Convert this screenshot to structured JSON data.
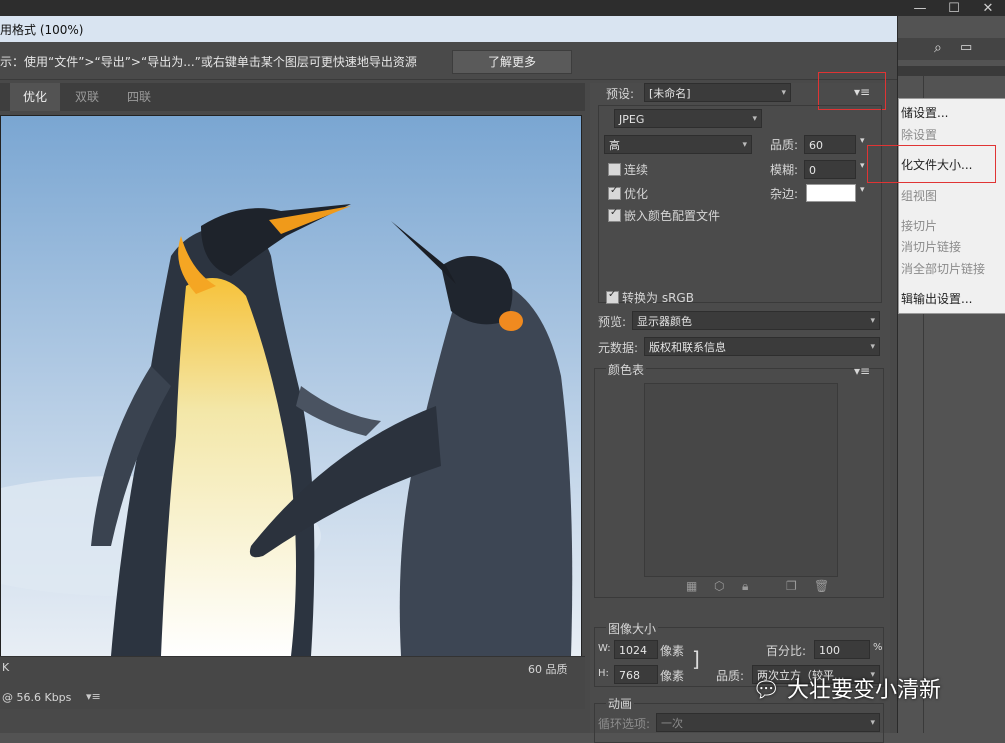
{
  "dialog": {
    "title": "用格式 (100%)",
    "hint": "示：使用“文件”>“导出”>“导出为...”或右键单击某个图层可更快速地导出资源",
    "learn_more": "了解更多"
  },
  "tabs": [
    {
      "label": "优化",
      "active": true
    },
    {
      "label": "双联",
      "active": false
    },
    {
      "label": "四联",
      "active": false
    }
  ],
  "image_info": {
    "line1": "K",
    "line2": "@ 56.6 Kbps",
    "quality": "60 品质"
  },
  "settings": {
    "preset_label": "预设:",
    "preset_value": "[未命名]",
    "format": "JPEG",
    "quality_level": "高",
    "quality_label": "品质:",
    "quality_value": "60",
    "progressive": "连续",
    "blur_label": "模糊:",
    "blur_value": "0",
    "optimized": "优化",
    "matte_label": "杂边:",
    "embed_profile": "嵌入颜色配置文件",
    "convert_srgb": "转换为 sRGB",
    "preview_label": "预览:",
    "preview_value": "显示器颜色",
    "metadata_label": "元数据:",
    "metadata_value": "版权和联系信息",
    "color_table": "颜色表"
  },
  "image_size": {
    "title": "图像大小",
    "w_label": "W:",
    "w_value": "1024",
    "h_label": "H:",
    "h_value": "768",
    "unit": "像素",
    "percent_label": "百分比:",
    "percent_value": "100",
    "percent_unit": "%",
    "quality_label": "品质:",
    "quality_value": "两次立方（较平..."
  },
  "animation": {
    "title": "动画",
    "loop_label": "循环选项:",
    "loop_value": "一次"
  },
  "context_menu": [
    {
      "label": "储设置...",
      "dim": false
    },
    {
      "label": "除设置",
      "dim": true
    },
    {
      "label": "化文件大小...",
      "dim": false
    },
    {
      "label": "组视图",
      "dim": true
    },
    {
      "label": "接切片",
      "dim": true
    },
    {
      "label": "消切片链接",
      "dim": true
    },
    {
      "label": "消全部切片链接",
      "dim": true
    },
    {
      "label": "辑输出设置...",
      "dim": false
    }
  ],
  "watermark": "大壮要变小清新",
  "colors": {
    "title_bar": "#d9e4f1",
    "panel": "#4b4b4b",
    "highlight": "#e03434"
  }
}
